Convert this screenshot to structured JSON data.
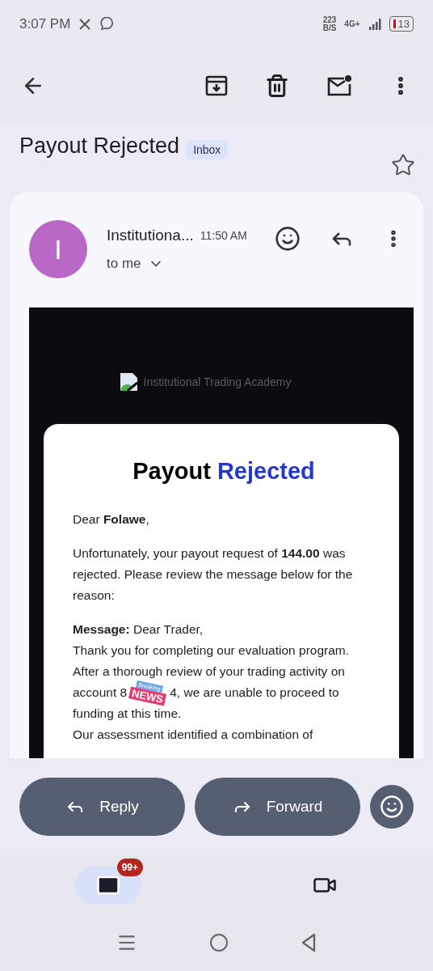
{
  "status_bar": {
    "time": "3:07 PM",
    "speed": "223",
    "speed_unit": "B/S",
    "network": "4G+",
    "battery": "13"
  },
  "subject": "Payout Rejected",
  "label": "Inbox",
  "starred": false,
  "sender": {
    "initial": "I",
    "name": "Institutiona...",
    "time": "11:50 AM",
    "recipient": "to me"
  },
  "email": {
    "logo_alt": "Institutional Trading Academy",
    "heading": "Payout",
    "heading_accent": "Rejected",
    "greeting": "Dear **Folawe**,",
    "intro": "Unfortunately, your payout request of **144.00** was rejected. Please review the message below for the reason:",
    "message_before": "**Message:** Dear Trader,\nThank you for completing our evaluation program.\nAfter a thorough review of your trading activity on",
    "account_before": "account 8",
    "sticker": {
      "top": "Breaking",
      "bottom": "NEWS"
    },
    "account_after": "4, we are unable to proceed to",
    "message_after": "funding at this time.\nOur assessment identified a combination of"
  },
  "actions": [
    {
      "kind": "reply",
      "label": "Reply"
    },
    {
      "kind": "forward",
      "label": "Forward"
    }
  ],
  "nav": [
    {
      "kind": "mail",
      "selected": true,
      "badge": "99+"
    },
    {
      "kind": "meet",
      "selected": false
    }
  ]
}
